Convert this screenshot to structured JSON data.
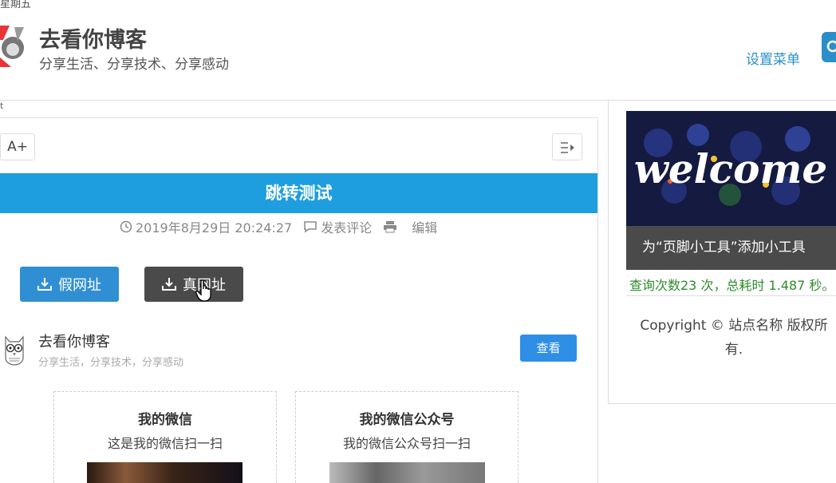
{
  "header": {
    "weekday": "星期五",
    "site_title": "去看你博客",
    "site_subtitle": "分享生活、分享技术、分享感动",
    "settings_menu": "设置菜单",
    "fragment_text": "t"
  },
  "post": {
    "font_button": "A+",
    "title": "跳转测试",
    "datetime": "2019年8月29日 20:24:27",
    "comment_label": "发表评论",
    "edit_label": "编辑",
    "fake_url_button": "假网址",
    "real_url_button": "真网址"
  },
  "author": {
    "name": "去看你博客",
    "desc": "分享生活，分享技术，分享感动",
    "view_button": "查看"
  },
  "qr_cards": [
    {
      "title": "我的微信",
      "desc": "这是我的微信扫一扫"
    },
    {
      "title": "我的微信公众号",
      "desc": "我的微信公众号扫一扫"
    }
  ],
  "sidebar": {
    "welcome_text": "welcome",
    "footer_tool": "为“页脚小工具”添加小工具",
    "query_stats": "查询次数23 次，总耗时 1.487 秒。",
    "copyright": "Copyright ©  站点名称  版权所有."
  },
  "colors": {
    "accent_blue": "#1e9ede",
    "button_blue": "#2f8fd2",
    "button_dark": "#4a4a4a",
    "stats_green": "#2e8b2e"
  }
}
